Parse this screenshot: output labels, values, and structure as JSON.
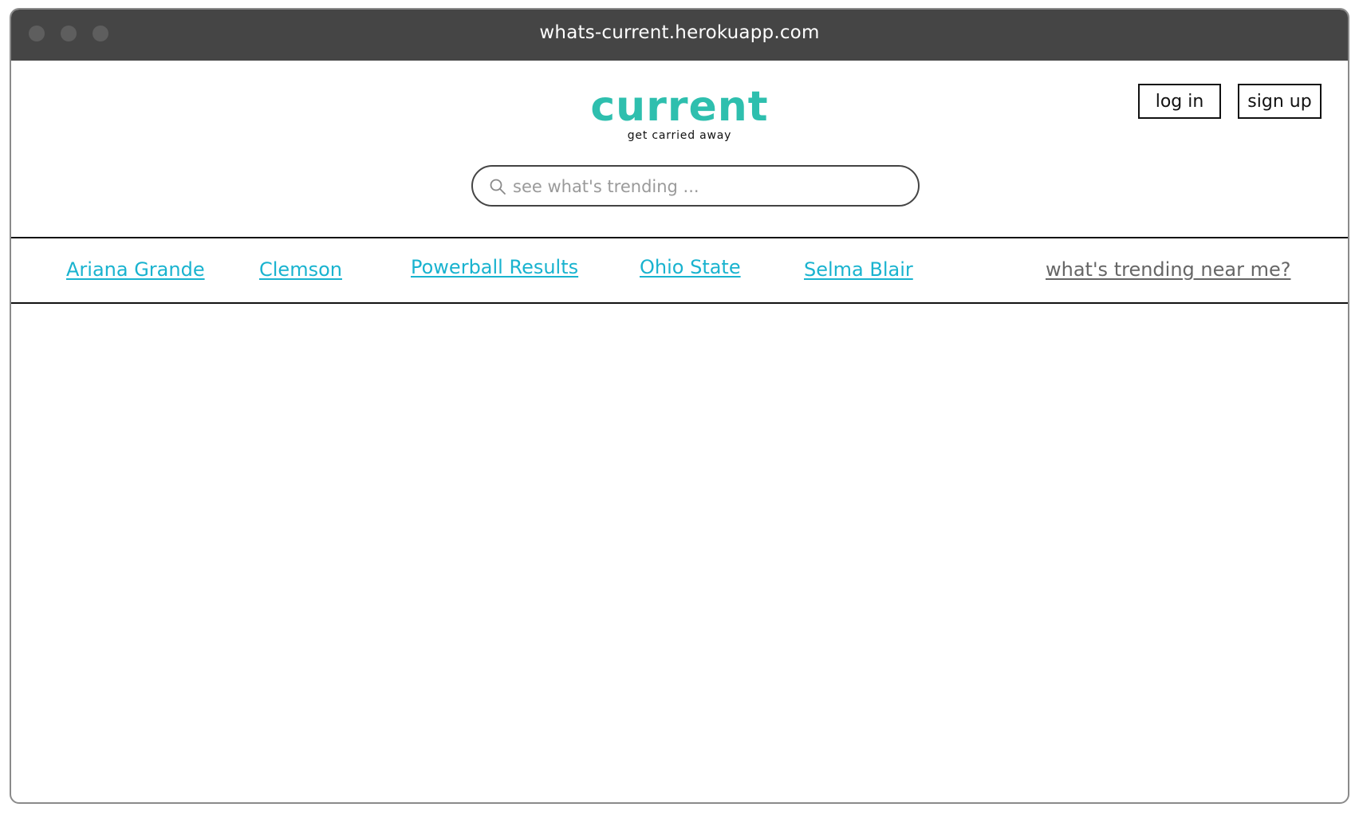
{
  "browser": {
    "url": "whats-current.herokuapp.com"
  },
  "header": {
    "logo_text": "current",
    "tagline": "get carried away",
    "login_label": "log in",
    "signup_label": "sign up"
  },
  "search": {
    "placeholder": "see what's trending ...",
    "value": ""
  },
  "trending": {
    "items": [
      {
        "label": "Ariana Grande"
      },
      {
        "label": "Clemson"
      },
      {
        "label": "Powerball Results"
      },
      {
        "label": "Ohio State"
      },
      {
        "label": "Selma Blair"
      }
    ],
    "near_me_label": "what's trending near me?"
  },
  "colors": {
    "brand": "#2ebfae",
    "link": "#19b3cf",
    "near_me_link": "#666666",
    "titlebar": "#454545"
  },
  "icons": {
    "search": "search-icon"
  }
}
